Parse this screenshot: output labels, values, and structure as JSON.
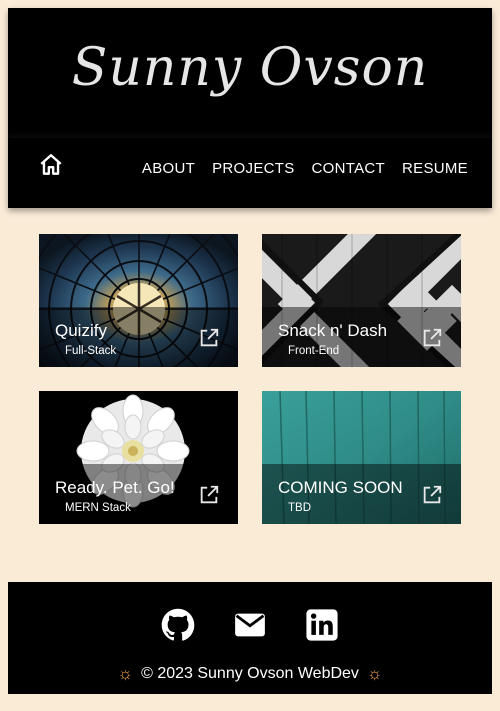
{
  "header": {
    "brand": "Sunny Ovson",
    "nav": [
      "ABOUT",
      "PROJECTS",
      "CONTACT",
      "RESUME"
    ]
  },
  "projects": [
    {
      "title": "Quizify",
      "subtitle": "Full-Stack"
    },
    {
      "title": "Snack n' Dash",
      "subtitle": "Front-End"
    },
    {
      "title": "Ready. Pet. Go!",
      "subtitle": "MERN Stack"
    },
    {
      "title": "COMING SOON",
      "subtitle": "TBD"
    }
  ],
  "footer": {
    "copyright": "© 2023 Sunny Ovson WebDev",
    "sun_symbol": "☼",
    "socials": [
      "github-icon",
      "mail-icon",
      "linkedin-icon"
    ]
  },
  "colors": {
    "page_background": "#faebd7",
    "header_background": "#000000",
    "footer_background": "#000000",
    "sun_accent": "#f0a24a",
    "coming_soon_teal": "#2f8c87"
  }
}
